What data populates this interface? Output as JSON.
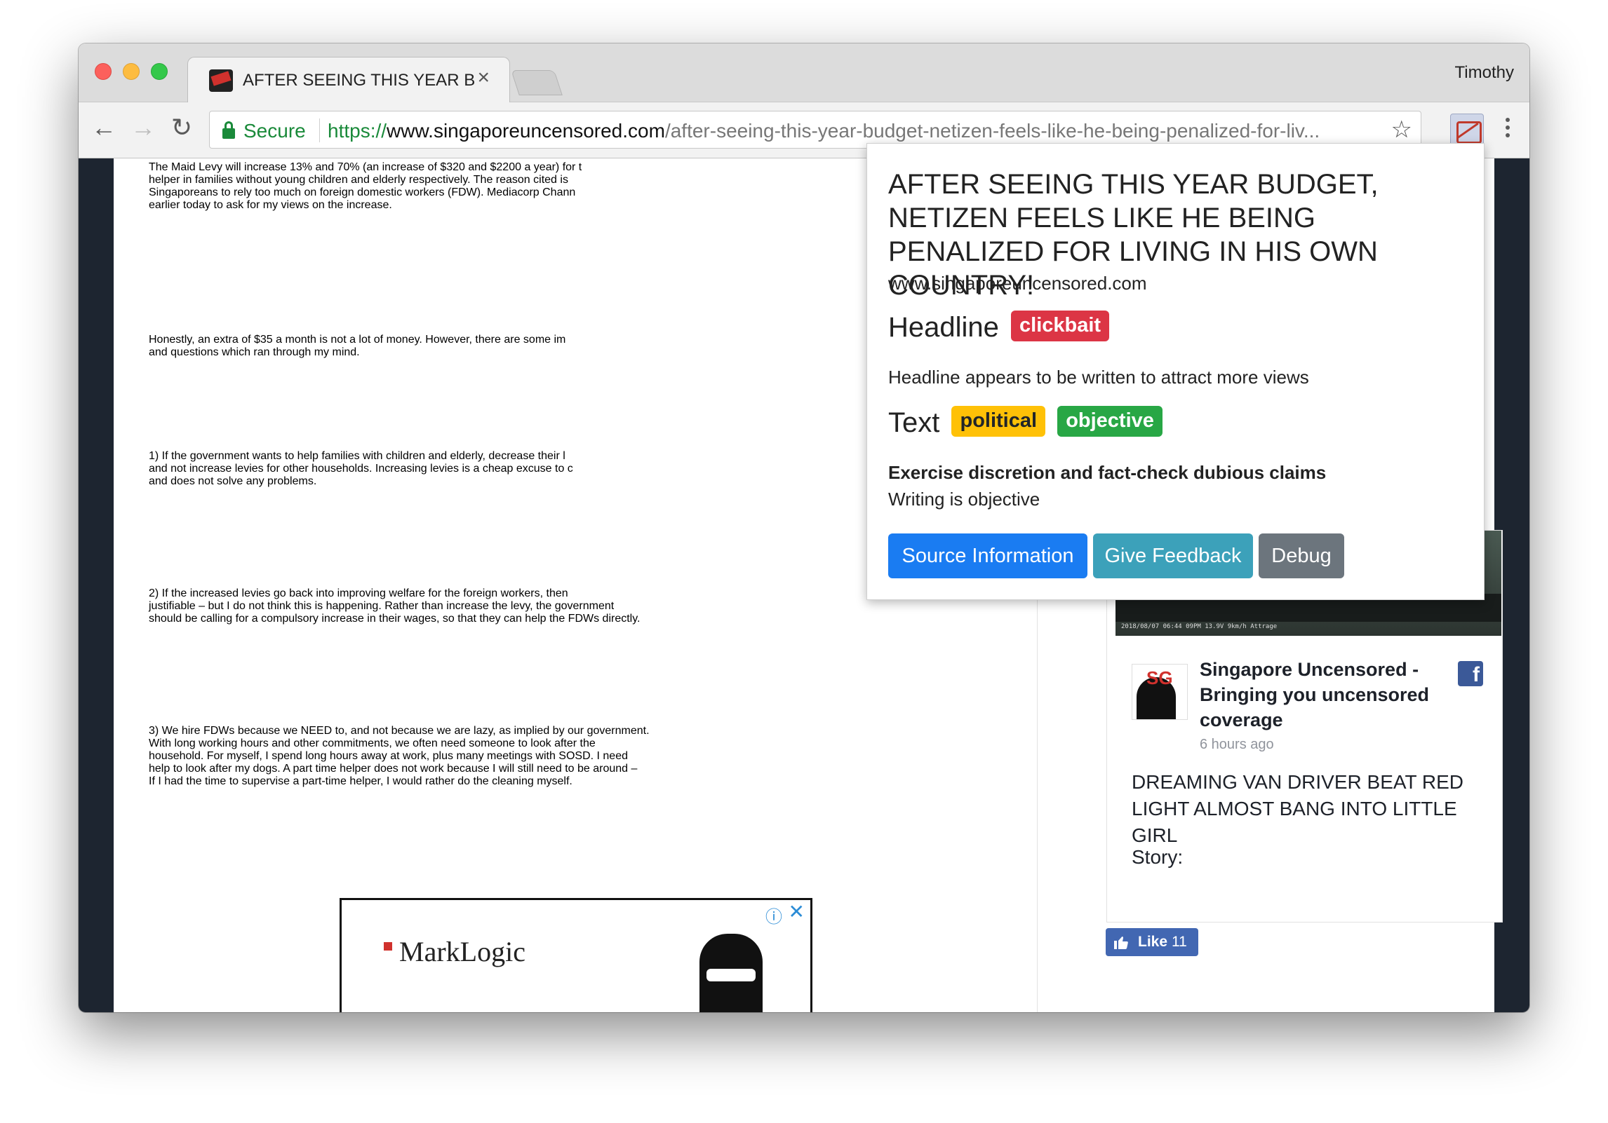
{
  "browser": {
    "tab_title": "AFTER SEEING THIS YEAR BUDGET",
    "tab_close": "×",
    "profile_name": "Timothy",
    "secure_label": "Secure",
    "url_scheme": "https://",
    "url_host": "www.singaporeuncensored.com",
    "url_path": "/after-seeing-this-year-budget-netizen-feels-like-he-being-penalized-for-liv...",
    "nav_back": "←",
    "nav_forward": "→",
    "nav_reload": "↻",
    "star": "☆"
  },
  "article": {
    "paragraphs": [
      [
        "The Maid Levy will increase 13% and 70% (an increase of $320 and $2200 a year) for t",
        "helper in families without young children and elderly respectively. The reason cited is",
        "Singaporeans to rely too much on foreign domestic workers (FDW). Mediacorp Chann",
        "earlier today to ask for my views on the increase."
      ],
      [
        "Honestly, an extra of $35 a month is not a lot of money. However, there are some im",
        "and questions which ran through my mind."
      ],
      [
        "1) If the government wants to help families with children and elderly, decrease their l",
        "and not increase levies for other households. Increasing levies is a cheap excuse to c",
        "and does not solve any problems."
      ],
      [
        "2) If the increased levies go back into improving welfare for the foreign workers, then",
        "justifiable – but I do not think this is happening. Rather than increase the levy, the government",
        "should be calling for a compulsory increase in their wages, so that they can help the FDWs directly."
      ],
      [
        "3) We hire FDWs because we NEED to, and not because we are lazy, as implied by our government.",
        "With long working hours and other commitments, we often need someone to look after the",
        "household. For myself, I spend long hours away at work, plus many meetings with SOSD. I need",
        "help to look after my dogs. A part time helper does not work because I will still need to be around –",
        "If I had the time to supervise a part-time helper, I would rather do the cleaning myself."
      ]
    ]
  },
  "ad": {
    "brand": "MarkLogic",
    "info": "ⓘ",
    "close": "✕"
  },
  "facebook": {
    "page_name": "Singapore Uncensored - Bringing you uncensored coverage",
    "time": "6 hours ago",
    "post_title": "DREAMING VAN DRIVER BEAT RED LIGHT ALMOST BANG INTO LITTLE GIRL",
    "story_label": "Story:",
    "like_label": "Like",
    "like_count": "11",
    "logo_letter": "f",
    "video_stamp": "2018/08/07 06:44 09PM 13.9V 9km/h Attrage"
  },
  "popup": {
    "title": "AFTER SEEING THIS YEAR BUDGET, NETIZEN FEELS LIKE HE BEING PENALIZED FOR LIVING IN HIS OWN COUNTRY!",
    "source": "www.singaporeuncensored.com",
    "headline_heading": "Headline",
    "headline_badge": "clickbait",
    "headline_note": "Headline appears to be written to attract more views",
    "text_heading": "Text",
    "text_badges": [
      "political",
      "objective"
    ],
    "text_warning": "Exercise discretion and fact-check dubious claims",
    "text_note": "Writing is objective",
    "buttons": {
      "source_info": "Source Information",
      "feedback": "Give Feedback",
      "debug": "Debug"
    }
  },
  "colors": {
    "clickbait": "#dc3545",
    "political": "#ffc107",
    "objective": "#28a745",
    "source_button": "#1a7cf2",
    "feedback_button": "#3ca1ba",
    "debug_button": "#6c757d"
  }
}
